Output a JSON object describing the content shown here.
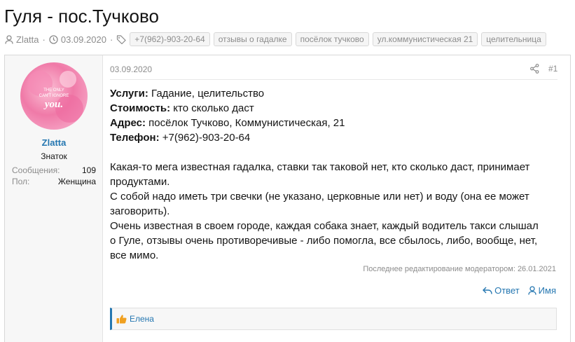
{
  "thread": {
    "title": "Гуля - пос.Тучково",
    "author": "Zlatta",
    "date": "03.09.2020",
    "tags": [
      "+7(962)-903-20-64",
      "отзывы о гадалке",
      "посёлок тучково",
      "ул.коммунистическая 21",
      "целительница"
    ]
  },
  "user": {
    "name": "Zlatta",
    "title": "Знаток",
    "stats": [
      {
        "label": "Сообщения:",
        "value": "109"
      },
      {
        "label": "Пол:",
        "value": "Женщина"
      }
    ],
    "avatar_text": [
      "THE ONLY",
      "CAN'T IGNORE",
      "you."
    ],
    "avatar_color": "#f07aa8"
  },
  "post": {
    "date": "03.09.2020",
    "number": "#1",
    "fields": [
      {
        "label": "Услуги:",
        "value": " Гадание, целительство"
      },
      {
        "label": "Стоимость:",
        "value": " кто сколько даст"
      },
      {
        "label": "Адрес:",
        "value": " посёлок Тучково, Коммунистическая, 21"
      },
      {
        "label": "Телефон:",
        "value": " +7(962)-903-20-64"
      }
    ],
    "paragraph_lines": [
      "Какая-то мега известная гадалка, ставки так таковой нет, кто сколько даст, принимает",
      "продуктами.",
      "С собой надо иметь три свечки (не указано, церковные или нет) и воду (она ее может",
      "заговорить).",
      "Очень известная в своем городе, каждая собака знает, каждый водитель такси слышал",
      "о Гуле, отзывы очень противоречивые - либо помогла, все сбылось, либо, вообще, нет,",
      "все мимо."
    ],
    "edited_note": "Последнее редактирование модератором: 26.01.2021",
    "reply_label": "Ответ",
    "name_label": "Имя",
    "reaction_user": "Елена"
  },
  "colors": {
    "link": "#2577b1",
    "muted": "#8c8c8c",
    "tag_bg": "#f5f5f5",
    "like": "#f0a020"
  }
}
